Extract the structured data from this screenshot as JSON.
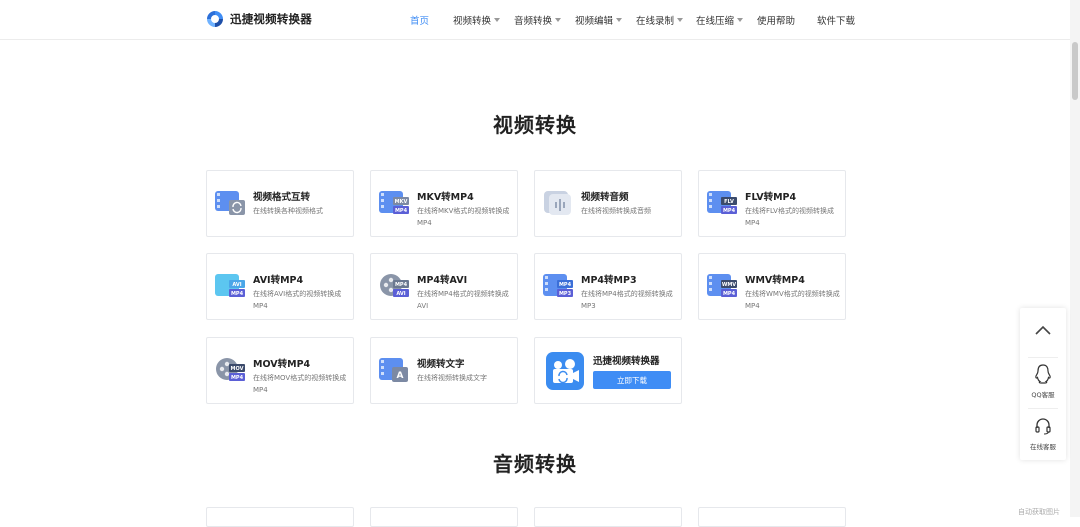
{
  "header": {
    "logo_text": "迅捷视频转换器",
    "nav": [
      {
        "label": "首页",
        "active": true,
        "dropdown": false
      },
      {
        "label": "视频转换",
        "active": false,
        "dropdown": true
      },
      {
        "label": "音频转换",
        "active": false,
        "dropdown": true
      },
      {
        "label": "视频编辑",
        "active": false,
        "dropdown": true
      },
      {
        "label": "在线录制",
        "active": false,
        "dropdown": true
      },
      {
        "label": "在线压缩",
        "active": false,
        "dropdown": true
      },
      {
        "label": "使用帮助",
        "active": false,
        "dropdown": false
      },
      {
        "label": "软件下载",
        "active": false,
        "dropdown": false
      }
    ]
  },
  "sections": {
    "video_title": "视频转换",
    "audio_title": "音频转换"
  },
  "cards": [
    {
      "title": "视频格式互转",
      "desc": "在线转换各种视频格式",
      "icon": "video-format-convert-icon"
    },
    {
      "title": "MKV转MP4",
      "desc": "在线将MKV格式的视频转换成MP4",
      "icon": "mkv-to-mp4-icon",
      "from": "MKV",
      "to": "MP4"
    },
    {
      "title": "视频转音频",
      "desc": "在线将视频转换成音频",
      "icon": "video-to-audio-icon"
    },
    {
      "title": "FLV转MP4",
      "desc": "在线将FLV格式的视频转换成MP4",
      "icon": "flv-to-mp4-icon",
      "from": "FLV",
      "to": "MP4"
    },
    {
      "title": "AVI转MP4",
      "desc": "在线将AVI格式的视频转换成MP4",
      "icon": "avi-to-mp4-icon",
      "from": "AVI",
      "to": "MP4"
    },
    {
      "title": "MP4转AVI",
      "desc": "在线将MP4格式的视频转换成AVI",
      "icon": "mp4-to-avi-icon",
      "from": "MP4",
      "to": "AVI"
    },
    {
      "title": "MP4转MP3",
      "desc": "在线将MP4格式的视频转换成MP3",
      "icon": "mp4-to-mp3-icon",
      "from": "MP4",
      "to": "MP3"
    },
    {
      "title": "WMV转MP4",
      "desc": "在线将WMV格式的视频转换成MP4",
      "icon": "wmv-to-mp4-icon",
      "from": "WMV",
      "to": "MP4"
    },
    {
      "title": "MOV转MP4",
      "desc": "在线将MOV格式的视频转换成MP4",
      "icon": "mov-to-mp4-icon",
      "from": "MOV",
      "to": "MP4"
    },
    {
      "title": "视频转文字",
      "desc": "在线将视频转换成文字",
      "icon": "video-to-text-icon",
      "badge": "A"
    }
  ],
  "promo": {
    "title": "迅捷视频转换器",
    "button": "立即下载",
    "icon": "app-camera-icon"
  },
  "side_panel": {
    "qq_label": "QQ客服",
    "online_label": "在线客服"
  },
  "watermark": "自动获取图片",
  "colors": {
    "accent": "#3f8df5",
    "icon_blue": "#5d8ff0",
    "icon_gray": "#8a95a8",
    "badge_purple": "#5b5fd6"
  }
}
